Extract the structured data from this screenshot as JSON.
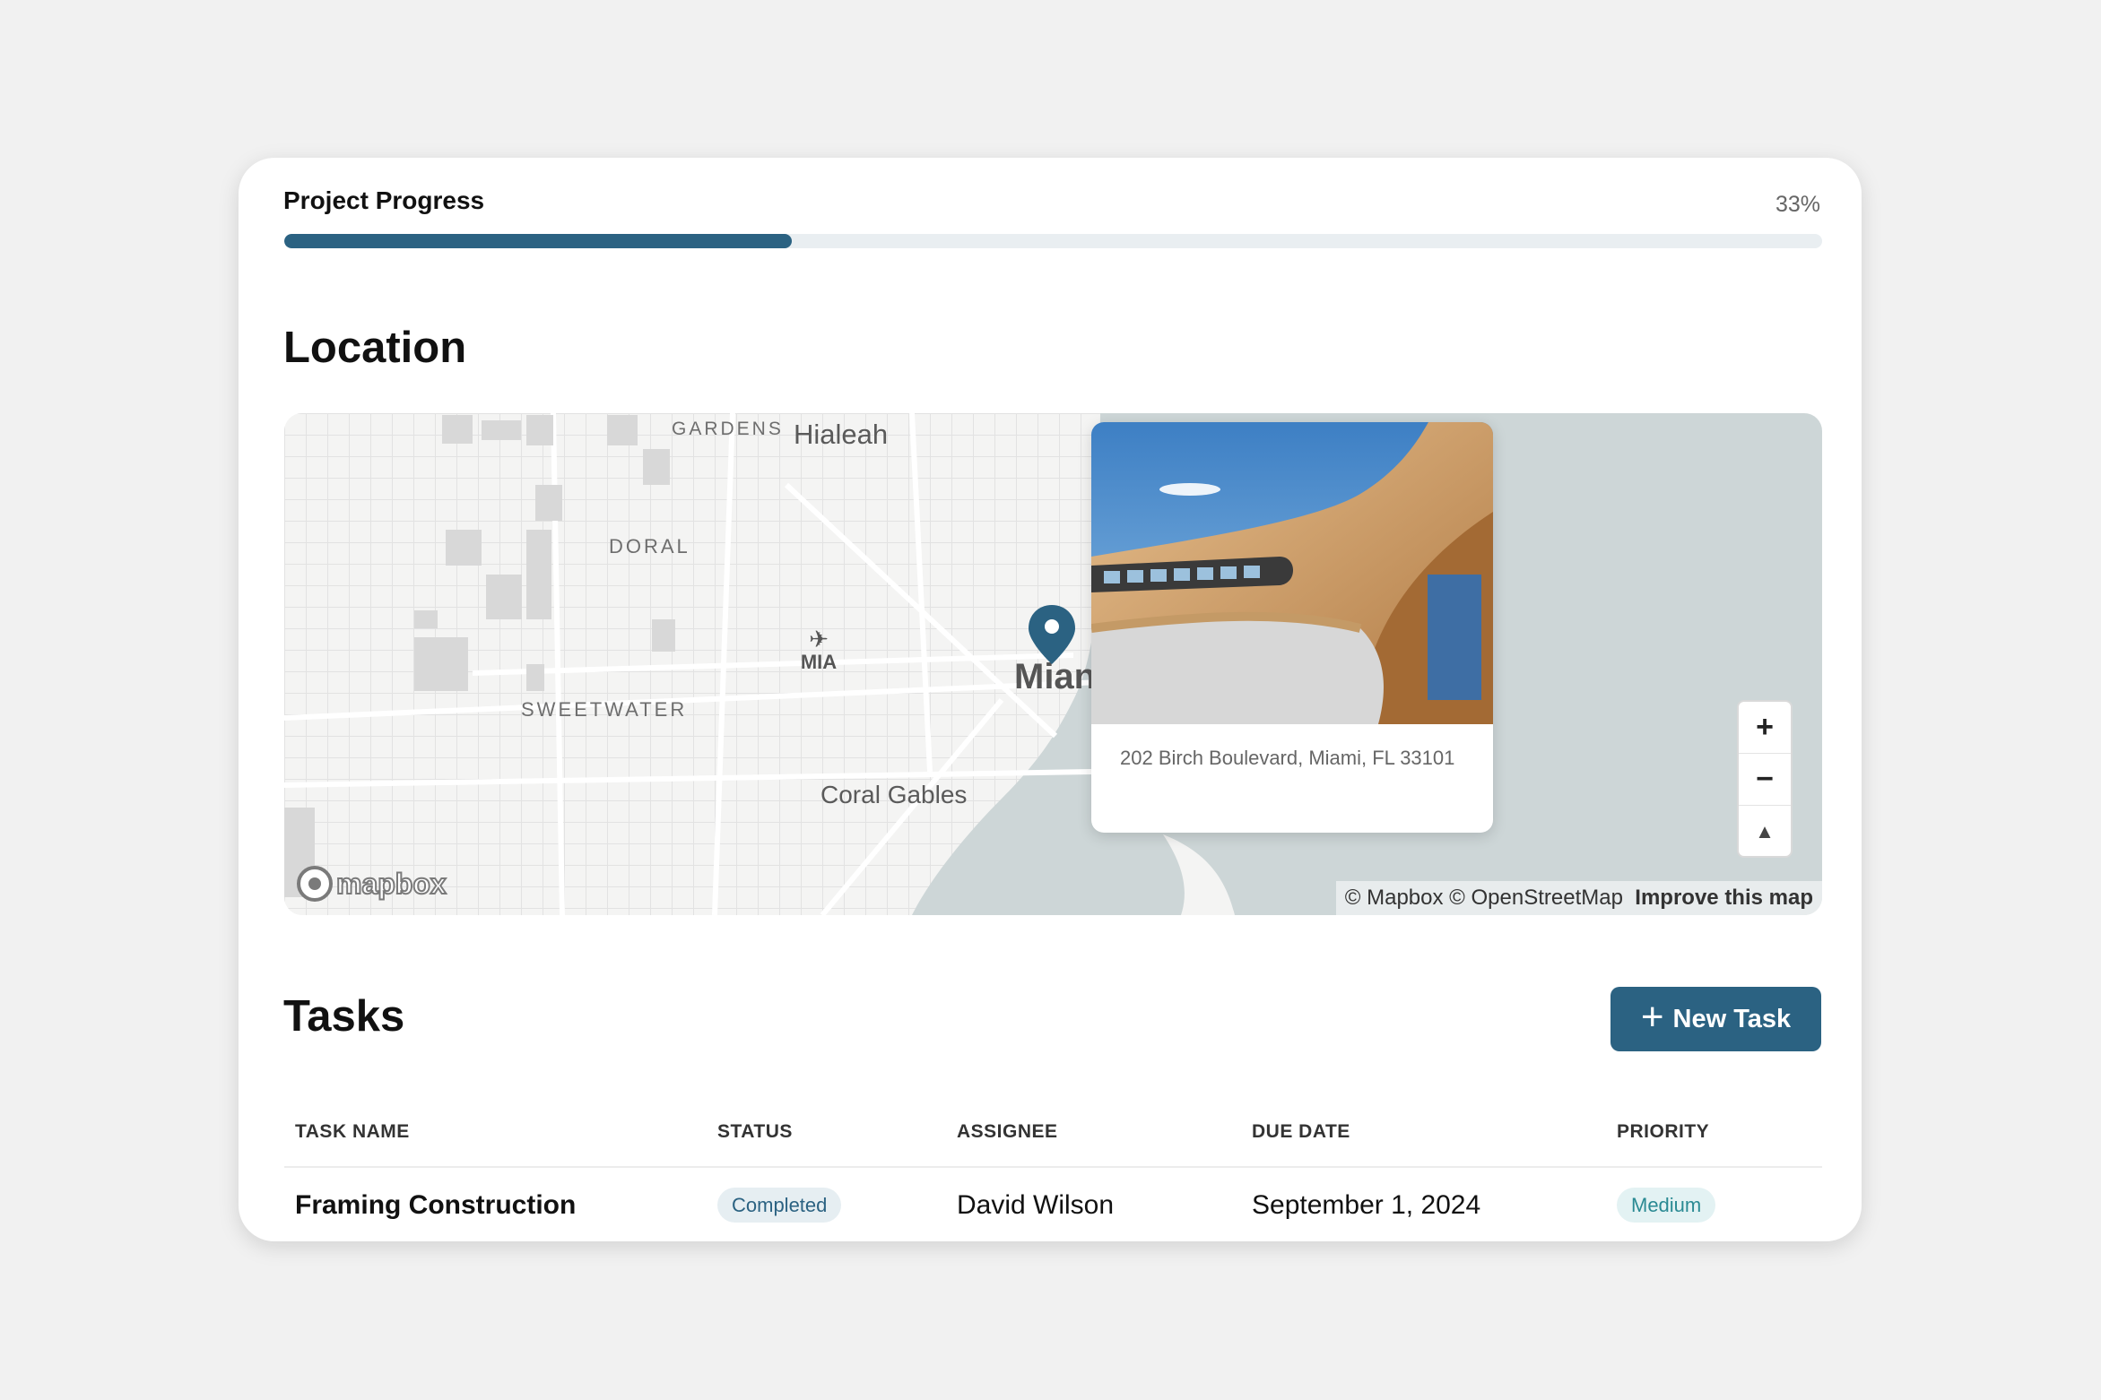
{
  "progress": {
    "title": "Project Progress",
    "percent_label": "33%",
    "value": 0.33
  },
  "location": {
    "title": "Location",
    "map": {
      "labels": {
        "gardens": "GARDENS",
        "hialeah": "Hialeah",
        "doral": "DORAL",
        "mia": "MIA",
        "miami": "Mian",
        "sweetwater": "SWEETWATER",
        "coral_gables": "Coral Gables"
      },
      "popup_address": "202 Birch Boulevard, Miami, FL 33101",
      "zoom_in": "+",
      "zoom_out": "−",
      "compass": "▲",
      "logo": "mapbox",
      "attribution": "© Mapbox © OpenStreetMap",
      "improve": "Improve this map"
    }
  },
  "tasks": {
    "title": "Tasks",
    "new_task_label": "New Task",
    "columns": [
      "TASK NAME",
      "STATUS",
      "ASSIGNEE",
      "DUE DATE",
      "PRIORITY"
    ],
    "rows": [
      {
        "name": "Framing Construction",
        "status": "Completed",
        "assignee": "David Wilson",
        "due": "September 1, 2024",
        "priority": "Medium"
      }
    ]
  },
  "colors": {
    "accent": "#2b6282",
    "priority_text": "#2a8a93",
    "water": "#cdd6d7"
  }
}
